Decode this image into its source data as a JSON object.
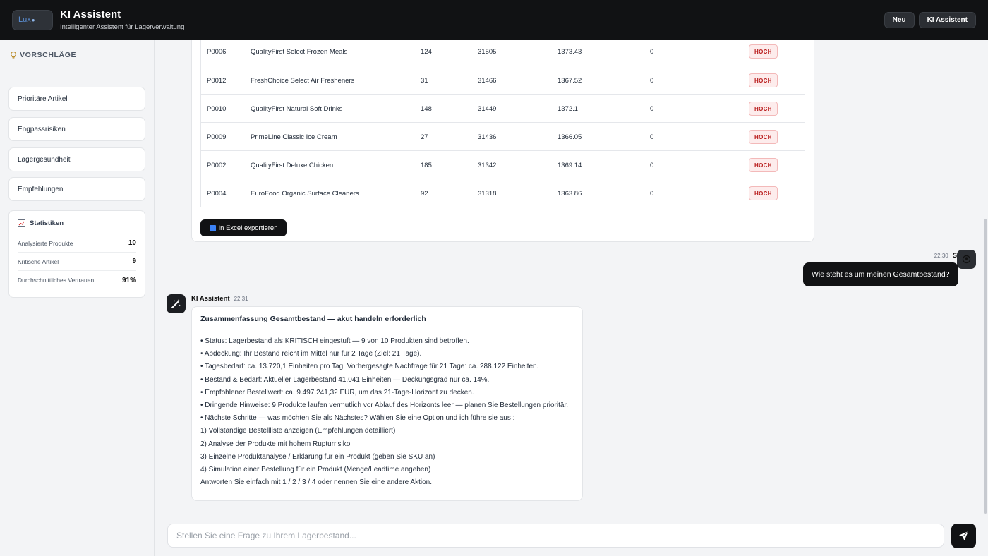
{
  "header": {
    "logo_text": "Lux",
    "logo_accent": "●",
    "title": "KI Assistent",
    "subtitle": "Intelligenter Assistent für Lagerverwaltung",
    "buttons": [
      "Neu",
      "KI Assistent"
    ]
  },
  "sidebar": {
    "heading": "VORSCHLÄGE",
    "items": [
      "Prioritäre Artikel",
      "Engpassrisiken",
      "Lagergesundheit",
      "Empfehlungen"
    ],
    "stats": {
      "title": "Statistiken",
      "rows": [
        {
          "label": "Analysierte Produkte",
          "value": "10"
        },
        {
          "label": "Kritische Artikel",
          "value": "9"
        },
        {
          "label": "Durchschnittliches Vertrauen",
          "value": "91%"
        }
      ]
    }
  },
  "table": {
    "rows": [
      {
        "sku": "P0006",
        "name": "QualityFirst Select Frozen Meals",
        "stock": "124",
        "demand": "31505",
        "value": "1373.43",
        "days": "0",
        "priority": "HOCH"
      },
      {
        "sku": "P0012",
        "name": "FreshChoice Select Air Fresheners",
        "stock": "31",
        "demand": "31466",
        "value": "1367.52",
        "days": "0",
        "priority": "HOCH"
      },
      {
        "sku": "P0010",
        "name": "QualityFirst Natural Soft Drinks",
        "stock": "148",
        "demand": "31449",
        "value": "1372.1",
        "days": "0",
        "priority": "HOCH"
      },
      {
        "sku": "P0009",
        "name": "PrimeLine Classic Ice Cream",
        "stock": "27",
        "demand": "31436",
        "value": "1366.05",
        "days": "0",
        "priority": "HOCH"
      },
      {
        "sku": "P0002",
        "name": "QualityFirst Deluxe Chicken",
        "stock": "185",
        "demand": "31342",
        "value": "1369.14",
        "days": "0",
        "priority": "HOCH"
      },
      {
        "sku": "P0004",
        "name": "EuroFood Organic Surface Cleaners",
        "stock": "92",
        "demand": "31318",
        "value": "1363.86",
        "days": "0",
        "priority": "HOCH"
      }
    ],
    "export_label": "In Excel exportieren"
  },
  "user_message": {
    "time": "22:30",
    "author": "Sie",
    "text": "Wie steht es um meinen Gesamtbestand?"
  },
  "bot_message": {
    "author": "KI Assistent",
    "time": "22:31",
    "title": "Zusammenfassung Gesamtbestand — akut handeln erforderlich",
    "lines": [
      "• Status: Lagerbestand als KRITISCH eingestuft — 9 von 10 Produkten sind betroffen.",
      "• Abdeckung: Ihr Bestand reicht im Mittel nur für 2 Tage (Ziel: 21 Tage).",
      "• Tagesbedarf: ca. 13.720,1 Einheiten pro Tag. Vorhergesagte Nachfrage für 21 Tage: ca. 288.122 Einheiten.",
      "• Bestand & Bedarf: Aktueller Lagerbestand 41.041 Einheiten — Deckungsgrad nur ca. 14%.",
      "• Empfohlener Bestellwert: ca. 9.497.241,32 EUR, um das 21-Tage-Horizont zu decken.",
      "• Dringende Hinweise: 9 Produkte laufen vermutlich vor Ablauf des Horizonts leer — planen Sie Bestellungen prioritär.",
      "• Nächste Schritte — was möchten Sie als Nächstes? Wählen Sie eine Option und ich führe sie aus :",
      "1) Vollständige Bestellliste anzeigen (Empfehlungen detailliert)",
      "2) Analyse der Produkte mit hohem Rupturrisiko",
      "3) Einzelne Produktanalyse / Erklärung für ein Produkt (geben Sie SKU an)",
      "4) Simulation einer Bestellung für ein Produkt (Menge/Leadtime angeben)",
      "Antworten Sie einfach mit 1 / 2 / 3 / 4 oder nennen Sie eine andere Aktion."
    ]
  },
  "composer": {
    "placeholder": "Stellen Sie eine Frage zu Ihrem Lagerbestand..."
  },
  "colors": {
    "header_bg": "#111214",
    "badge_text": "#b91c1c",
    "badge_bg": "#fdecec"
  }
}
